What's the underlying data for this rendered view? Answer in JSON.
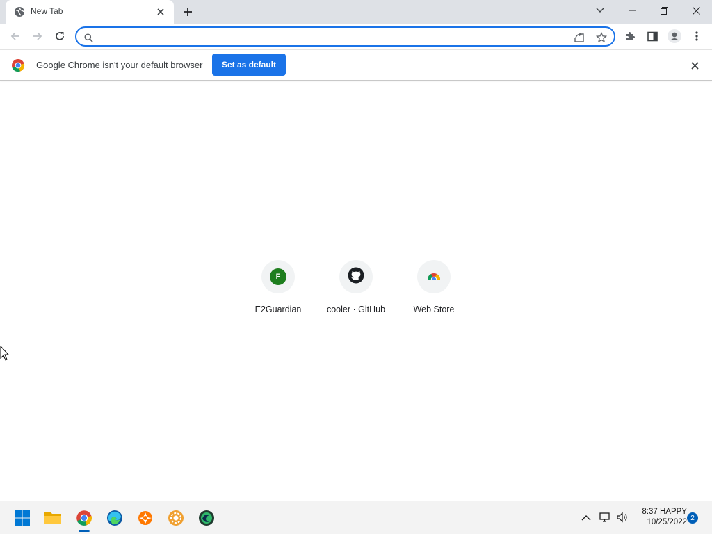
{
  "browser": {
    "tab": {
      "title": "New Tab"
    },
    "omnibox": {
      "value": "",
      "placeholder": ""
    },
    "infobar": {
      "message": "Google Chrome isn't your default browser",
      "button_label": "Set as default"
    },
    "accent_color": "#1a73e8"
  },
  "shortcuts": [
    {
      "label": "E2Guardian",
      "icon": "letter-F",
      "letter": "F",
      "icon_color": "#1e7e1e"
    },
    {
      "label": "cooler · GitHub",
      "icon": "github-icon"
    },
    {
      "label": "Web Store",
      "icon": "chrome-web-store-icon"
    }
  ],
  "taskbar": {
    "apps": [
      "start",
      "file-explorer",
      "chrome",
      "edge",
      "avast",
      "settings-gear",
      "edge-dev"
    ],
    "clock": {
      "time": "8:37 HAPPY",
      "date": "10/25/2022"
    },
    "notification_count": "2",
    "accent_color": "#005fb8"
  }
}
